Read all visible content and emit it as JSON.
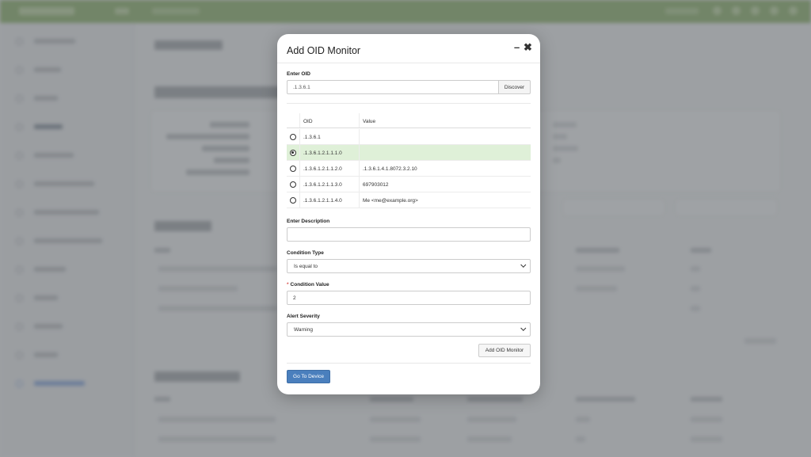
{
  "modal": {
    "title": "Add OID Monitor",
    "minimize_icon": "minimize-icon",
    "close_icon": "close-icon"
  },
  "oid_field": {
    "label": "Enter OID",
    "value": ".1.3.6.1",
    "discover_label": "Discover"
  },
  "oid_table": {
    "headers": {
      "oid": "OID",
      "value": "Value"
    },
    "rows": [
      {
        "oid": ".1.3.6.1",
        "value": "",
        "selected": false
      },
      {
        "oid": ".1.3.6.1.2.1.1.1.0",
        "value": "",
        "selected": true
      },
      {
        "oid": ".1.3.6.1.2.1.1.2.0",
        "value": ".1.3.6.1.4.1.8072.3.2.10",
        "selected": false
      },
      {
        "oid": ".1.3.6.1.2.1.1.3.0",
        "value": "697903012",
        "selected": false
      },
      {
        "oid": ".1.3.6.1.2.1.1.4.0",
        "value": "Me <me@example.org>",
        "selected": false
      }
    ]
  },
  "description": {
    "label": "Enter Description",
    "value": ""
  },
  "condition_type": {
    "label": "Condition Type",
    "selected": "Is equal to"
  },
  "condition_value": {
    "required_marker": "*",
    "label": "Condition Value",
    "value": "2"
  },
  "alert_severity": {
    "label": "Alert Severity",
    "selected": "Warning"
  },
  "actions": {
    "add_label": "Add OID Monitor",
    "goto_label": "Go To Device"
  },
  "colors": {
    "selected_row": "#dff0d8",
    "primary_button": "#4a7fbd",
    "required": "#d9534f",
    "topbar": "#8aaf6a"
  }
}
